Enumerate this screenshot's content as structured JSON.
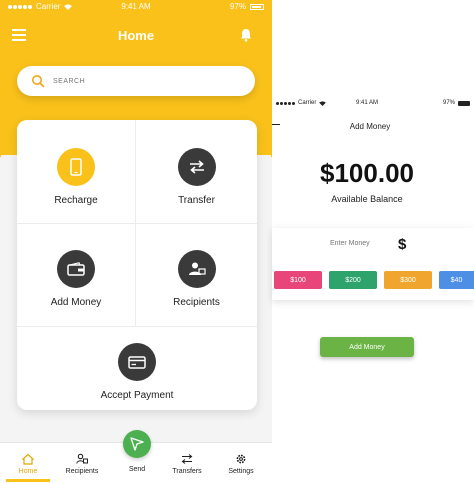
{
  "home_screen": {
    "status": {
      "carrier": "Carrier",
      "time": "9:41 AM",
      "battery": "97%"
    },
    "title": "Home",
    "search": {
      "placeholder": "SEARCH"
    },
    "tiles": [
      {
        "label": "Recharge",
        "icon": "phone-icon"
      },
      {
        "label": "Transfer",
        "icon": "transfer-arrows-icon"
      },
      {
        "label": "Add Money",
        "icon": "wallet-icon"
      },
      {
        "label": "Recipients",
        "icon": "recipients-icon"
      },
      {
        "label": "Accept Payment",
        "icon": "card-icon"
      }
    ],
    "tabbar": {
      "home": "Home",
      "recipients": "Recipients",
      "send": "Send",
      "transfers": "Transfers",
      "settings": "Settings"
    },
    "colors": {
      "accent": "#f9c11a",
      "send": "#4caf50",
      "icon_circle": "#3a3a3a"
    }
  },
  "add_money_screen": {
    "status": {
      "carrier": "Carrier",
      "time": "9:41 AM",
      "battery": "97%"
    },
    "title": "Add Money",
    "balance": "$100.00",
    "balance_label": "Available Balance",
    "enter_placeholder": "Enter Money",
    "currency_symbol": "$",
    "amount_chips": [
      {
        "label": "$100",
        "color": "#e8457a"
      },
      {
        "label": "$200",
        "color": "#2ea36b"
      },
      {
        "label": "$300",
        "color": "#f0a62e"
      },
      {
        "label": "$40",
        "color": "#4e8fe6"
      }
    ],
    "add_button": "Add Money"
  }
}
